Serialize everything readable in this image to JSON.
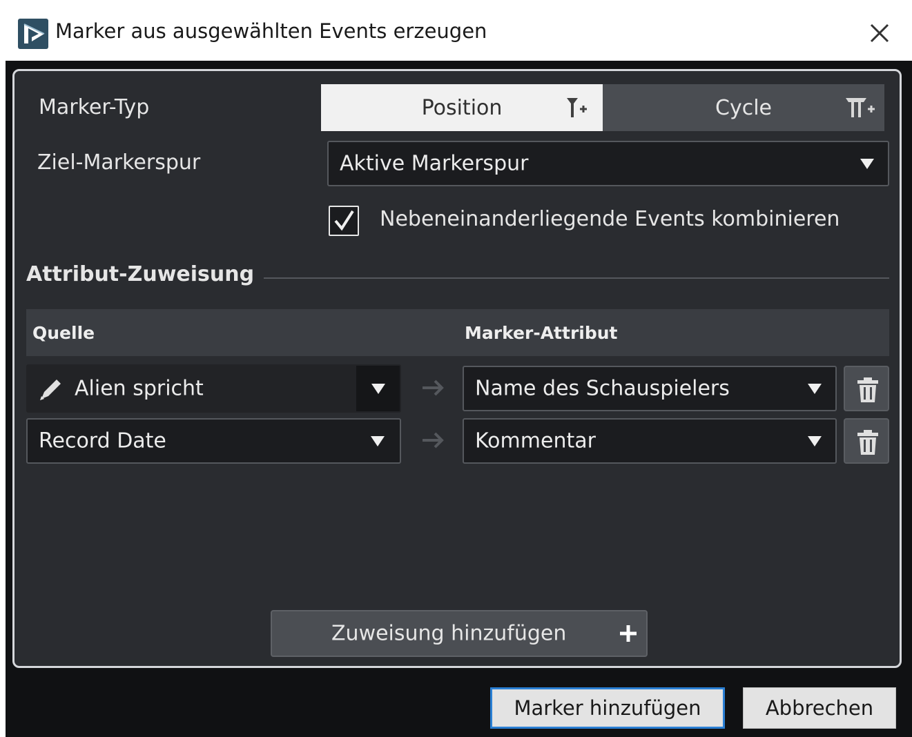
{
  "window": {
    "title": "Marker aus ausgewählten Events erzeugen",
    "app_icon": "app-logo-icon",
    "close_icon": "close-icon"
  },
  "form": {
    "marker_type_label": "Marker-Typ",
    "marker_type_options": [
      "Position",
      "Cycle"
    ],
    "marker_type_selected": "Position",
    "target_track_label": "Ziel-Markerspur",
    "target_track_value": "Aktive Markerspur",
    "combine_checkbox_label": "Nebeneinanderliegende Events kombinieren",
    "combine_checked": true
  },
  "attributes": {
    "section_title": "Attribut-Zuweisung",
    "col_source": "Quelle",
    "col_marker_attribute": "Marker-Attribut",
    "rows": [
      {
        "source": "Alien spricht",
        "source_editable": true,
        "target": "Name des Schauspielers"
      },
      {
        "source": "Record Date",
        "source_editable": false,
        "target": "Kommentar"
      }
    ],
    "add_button_label": "Zuweisung hinzufügen"
  },
  "footer": {
    "ok_label": "Marker hinzufügen",
    "cancel_label": "Abbrechen"
  },
  "colors": {
    "accent": "#2a7fd4",
    "panel_bg": "#2a2c30",
    "dark_bg": "#101113"
  }
}
